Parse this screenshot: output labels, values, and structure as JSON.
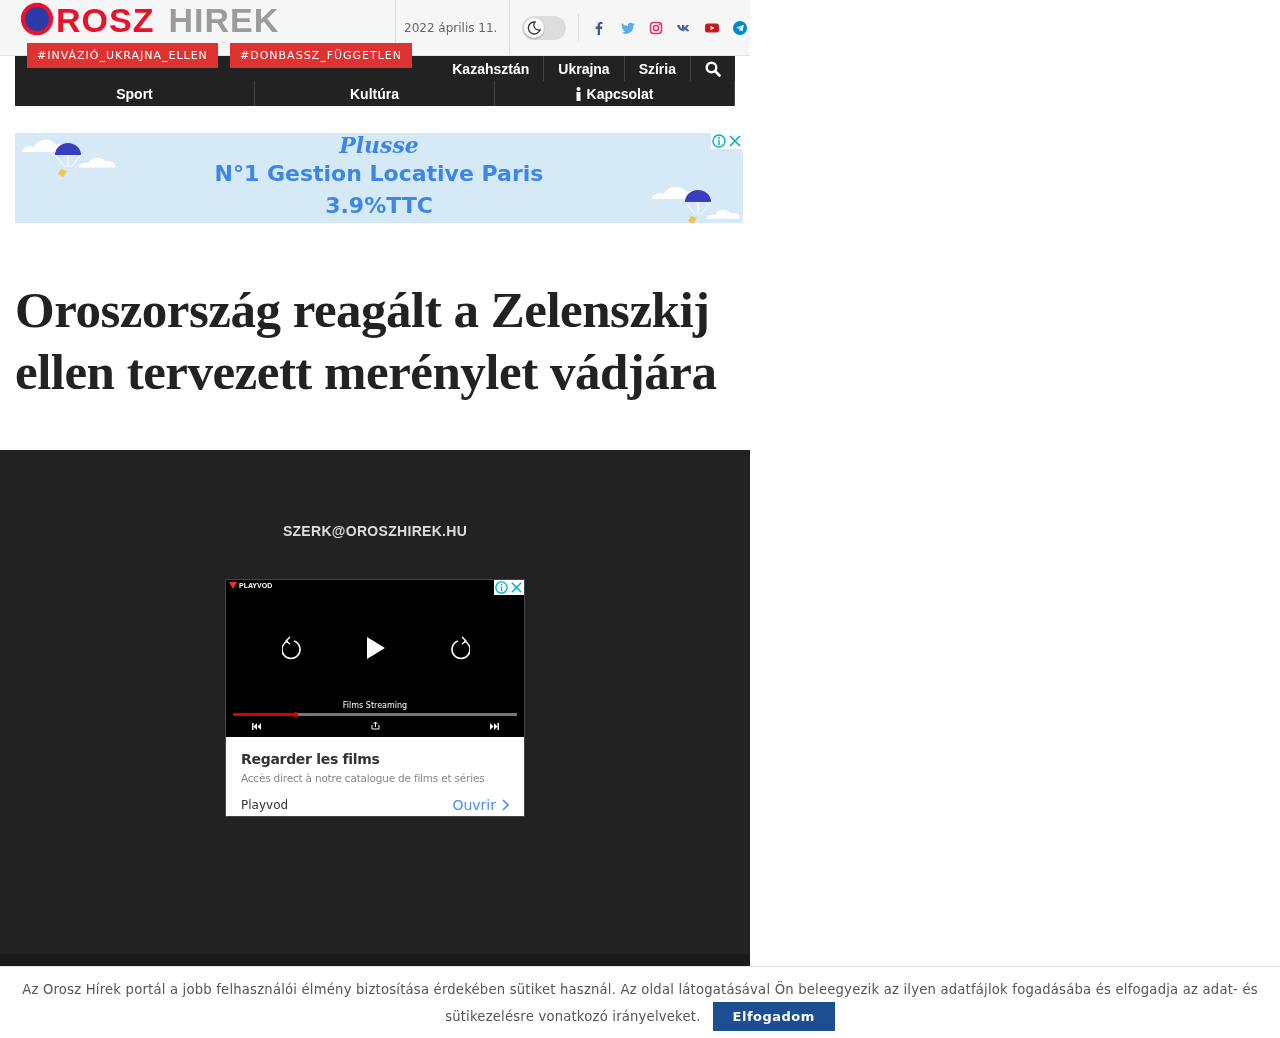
{
  "header": {
    "logo_main": "ROSZ",
    "logo_accent": "HIREK",
    "date": "2022 április 11.",
    "dark_mode": {
      "on": false
    }
  },
  "tags": [
    "#INVÁZIÓ_UKRAJNA_ELLEN",
    "#DONBASSZ_FÜGGETLEN"
  ],
  "nav": {
    "rows": [
      [
        "Kazahsztán",
        "Ukrajna",
        "Szíria"
      ],
      [
        "Sport",
        "Kultúra",
        "Kapcsolat"
      ]
    ]
  },
  "banner_ad": {
    "brand": "Plusse",
    "headline": "N°1 Gestion Locative Paris",
    "price": "3.9%TTC"
  },
  "article": {
    "title": "Oroszország reagált a Zelenszkij ellen tervezett merénylet vádjára"
  },
  "footer": {
    "email": "SZERK@OROSZHIREK.HU",
    "video_ad": {
      "brand": "PLAYVOD",
      "caption": "Films Streaming",
      "progress": {
        "level": 0.22
      },
      "title": "Regarder les films",
      "description": "Accès direct à notre catalogue de films et séries",
      "advertiser": "Playvod",
      "action": "Ouvrir"
    }
  },
  "cookie_notice": {
    "text": "Az Orosz Hírek portál a jobb felhasználói élmény biztosítása érdekében sütiket használ. Az oldal látogatásával Ön beleegyezik az ilyen adatfájlok fogadásába és elfogadja az adat- és sütikezelésre vonatkozó irányelveket.",
    "button": "Elfogadom"
  }
}
